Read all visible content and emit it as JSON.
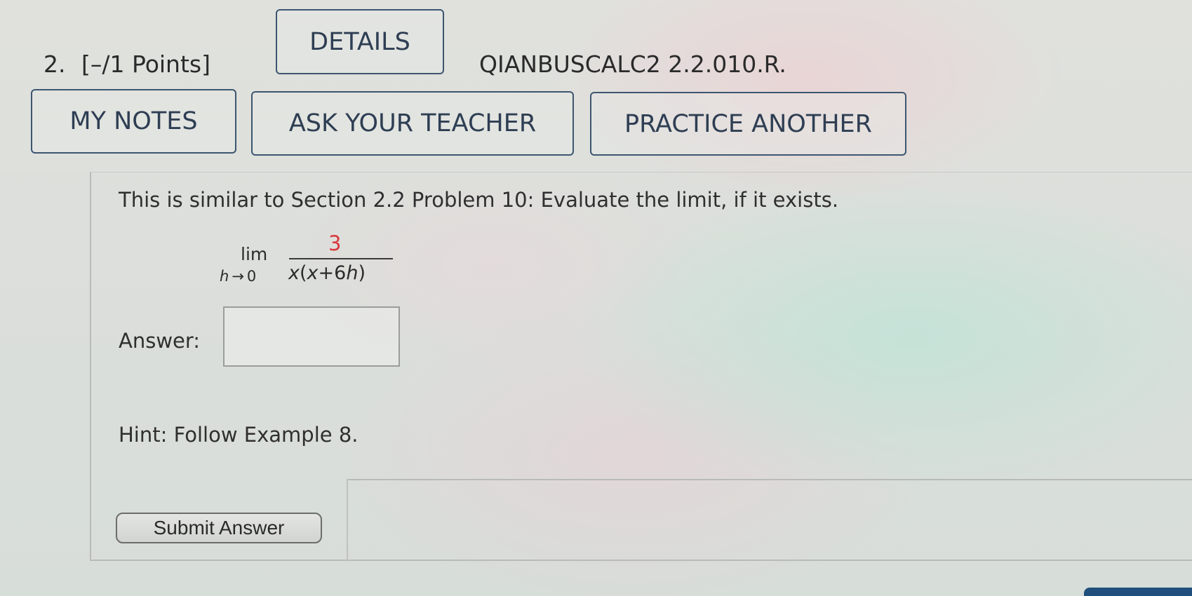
{
  "question": {
    "number": "2.",
    "points": "[–/1 Points]",
    "details_label": "DETAILS",
    "code": "QIANBUSCALC2 2.2.010.R."
  },
  "actions": {
    "my_notes": "MY NOTES",
    "ask_teacher": "ASK YOUR TEACHER",
    "practice_another": "PRACTICE ANOTHER"
  },
  "problem": {
    "text": "This is similar to Section 2.2 Problem 10: Evaluate the limit, if it exists.",
    "limit_word": "lim",
    "limit_variable": "h",
    "limit_arrow": "→",
    "limit_target": "0",
    "numerator": "3",
    "denominator_parts": {
      "x1": "x",
      "open": "(",
      "x2": "x",
      "plus": "+6",
      "h": "h",
      "close": ")"
    },
    "numerator_color": "#d9383d"
  },
  "answer": {
    "label": "Answer:",
    "value": "",
    "placeholder": ""
  },
  "hint": "Hint: Follow Example 8.",
  "submit_label": "Submit Answer"
}
